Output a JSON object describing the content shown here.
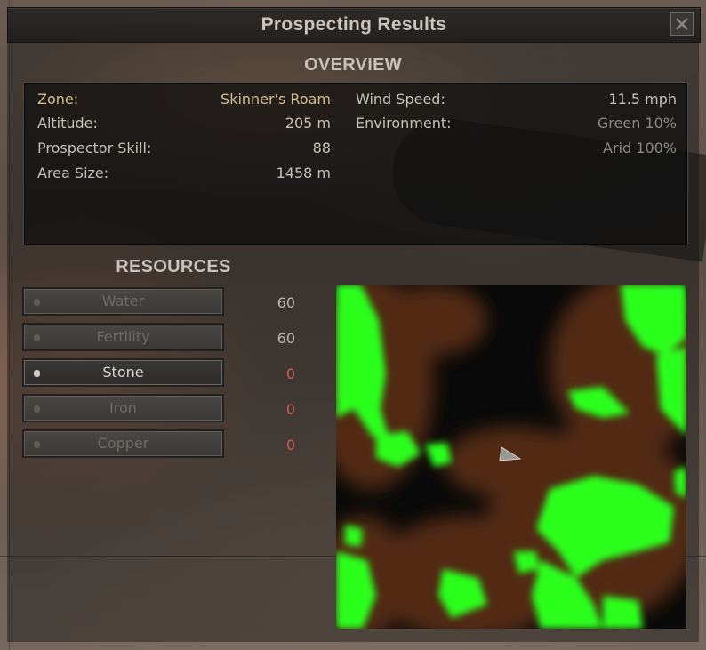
{
  "window": {
    "title": "Prospecting Results",
    "close_icon": "close-icon"
  },
  "overview": {
    "heading": "OVERVIEW",
    "left": [
      {
        "label": "Zone:",
        "value": "Skinner's Roam"
      },
      {
        "label": "Altitude:",
        "value": "205 m"
      },
      {
        "label": "Prospector Skill:",
        "value": "88"
      },
      {
        "label": "Area Size:",
        "value": "1458 m"
      }
    ],
    "right": [
      {
        "label": "Wind Speed:",
        "value": "11.5 mph"
      },
      {
        "label": "Environment:",
        "value": "Green 10%"
      },
      {
        "label": "",
        "value": "Arid 100%"
      }
    ]
  },
  "resources": {
    "heading": "RESOURCES",
    "items": [
      {
        "label": "Water",
        "value": "60",
        "active": false
      },
      {
        "label": "Fertility",
        "value": "60",
        "active": false
      },
      {
        "label": "Stone",
        "value": "0",
        "active": true
      },
      {
        "label": "Iron",
        "value": "0",
        "active": false
      },
      {
        "label": "Copper",
        "value": "0",
        "active": false
      }
    ]
  },
  "colors": {
    "accent_gold": "#d6bd8c",
    "zero_value": "#d25c55",
    "resource_map_green": "#2cff1c"
  }
}
